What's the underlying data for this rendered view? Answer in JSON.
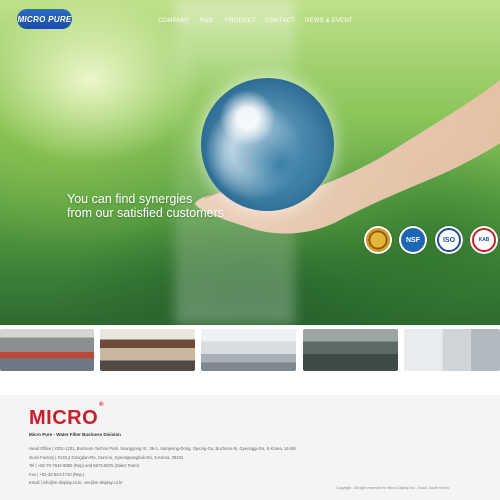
{
  "header": {
    "logo_text": "MICRO PURE",
    "nav": [
      "COMPANY",
      "R&D",
      "PRODUCT",
      "CONTACT",
      "NEWS & EVENT"
    ]
  },
  "hero": {
    "tagline_line1": "You can find synergies",
    "tagline_line2": "from our satisfied customers"
  },
  "certifications": [
    {
      "name": "gold-seal",
      "label": ""
    },
    {
      "name": "nsf",
      "label": "NSF"
    },
    {
      "name": "iso",
      "label": "ISO"
    },
    {
      "name": "kc",
      "label": "KAB"
    }
  ],
  "thumbnails": [
    {
      "name": "factory-floor"
    },
    {
      "name": "warehouse"
    },
    {
      "name": "building-exterior"
    },
    {
      "name": "production-line"
    },
    {
      "name": "clean-room"
    }
  ],
  "footer": {
    "logo": "MICRO",
    "logo_mark": "®",
    "division": "Micro Pure - Water Filter Business Division",
    "lines": [
      "Head Office  |  #301-1201, Bucheon-Techno Park, Ssangyong III , 36-1, Samjeong-Dong, Ojeong-Gu, Bucheon-Si, Gyeonggi-Do, S.Korea, 14449",
      "Gumi Factory  |  #133,4 Gongdan-Ro, Gumi-si, Gyeongsangbuk-Do, S.Korea, 39422",
      "Tel  |  +82-70-7842-8880 (Rep) and 8673-8875 (Sales Team)",
      "Fax  |  +82-32-624-1740 (Rep.)",
      "Email  |  info@m-display.co.kr, cee@m-display.co.kr"
    ],
    "copyright": "Copyright . All right reserved for Micro Display Inc., Seoul, South Korea"
  },
  "colors": {
    "brand_blue": "#1b4f9c",
    "brand_red": "#c8202b",
    "footer_bg": "#f4f4f4"
  }
}
